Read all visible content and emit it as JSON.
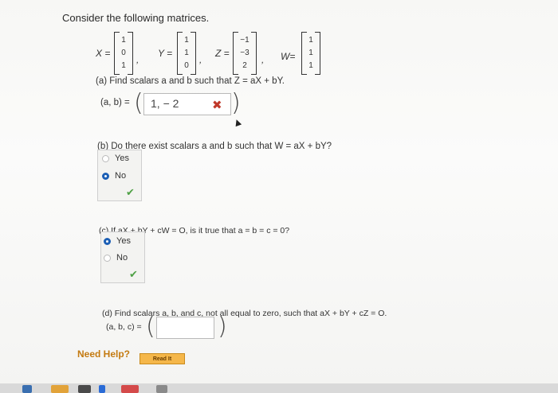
{
  "title": "Consider the following matrices.",
  "matrices": [
    {
      "name": "X =",
      "values": [
        "1",
        "0",
        "1"
      ]
    },
    {
      "name": "Y =",
      "values": [
        "1",
        "1",
        "0"
      ]
    },
    {
      "name": "Z =",
      "values": [
        "−1",
        "−3",
        "2"
      ]
    },
    {
      "name": "W=",
      "values": [
        "1",
        "1",
        "1"
      ]
    }
  ],
  "separators": [
    ",",
    ",",
    ","
  ],
  "part_a": {
    "question": "(a) Find scalars a and b such that Z = aX + bY.",
    "label": "(a, b) =",
    "answer_value": "1, − 2",
    "result_icon": "x-mark-icon"
  },
  "part_b": {
    "question": "(b) Do there exist scalars a and b such that W = aX + bY?",
    "options": [
      "Yes",
      "No"
    ],
    "selected": "No",
    "result_icon": "check-icon"
  },
  "part_c": {
    "question": "(c) If aX + bY + cW = O, is it true that a = b = c = 0?",
    "options": [
      "Yes",
      "No"
    ],
    "selected": "Yes",
    "result_icon": "check-icon"
  },
  "part_d": {
    "question": "(d) Find scalars a, b, and c, not all equal to zero, such that aX + bY + cZ = O.",
    "label": "(a, b, c) =",
    "answer_value": ""
  },
  "help": {
    "label": "Need Help?",
    "button": "Read It"
  },
  "colors": {
    "selected_radio": "#1c5fb5",
    "correct": "#4fa146",
    "incorrect": "#c0392b",
    "help_text": "#c47a10",
    "read_button": "#f5b74a"
  }
}
